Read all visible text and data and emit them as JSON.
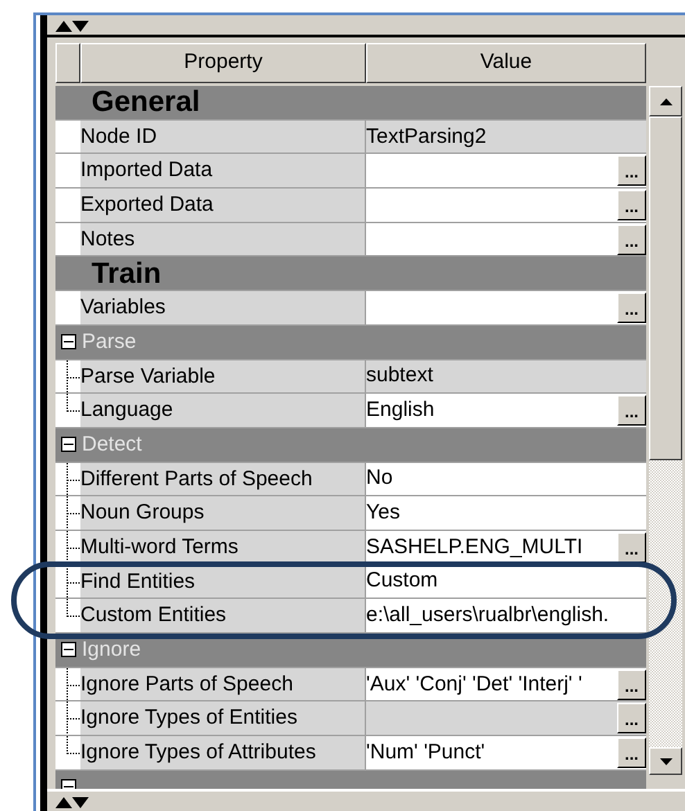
{
  "columns": [
    "Property",
    "Value"
  ],
  "groups": [
    {
      "kind": "section",
      "title": "General",
      "rows": [
        {
          "label": "Node ID",
          "value": "TextParsing2",
          "editable": false
        },
        {
          "label": "Imported Data",
          "editable": true,
          "button": "..."
        },
        {
          "label": "Exported Data",
          "editable": true,
          "button": "..."
        },
        {
          "label": "Notes",
          "editable": true,
          "button": "..."
        }
      ]
    },
    {
      "kind": "section",
      "title": "Train",
      "rows": [
        {
          "label": "Variables",
          "editable": true,
          "button": "..."
        }
      ]
    },
    {
      "kind": "category",
      "title": "Parse",
      "expanded": true,
      "rows": [
        {
          "label": "Parse Variable",
          "value": "subtext",
          "editable": false
        },
        {
          "label": "Language",
          "value": "English",
          "editable": true,
          "button": "..."
        }
      ]
    },
    {
      "kind": "category",
      "title": "Detect",
      "expanded": true,
      "rows": [
        {
          "label": "Different Parts of Speech",
          "value": "No",
          "editable": true
        },
        {
          "label": "Noun Groups",
          "value": "Yes",
          "editable": true
        },
        {
          "label": "Multi-word Terms",
          "value": "SASHELP.ENG_MULTI",
          "editable": true,
          "button": "..."
        },
        {
          "label": "Find Entities",
          "value": "Custom",
          "editable": true
        },
        {
          "label": "Custom Entities",
          "value": "e:\\all_users\\rualbr\\english.",
          "editable": true
        }
      ]
    },
    {
      "kind": "category",
      "title": "Ignore",
      "expanded": true,
      "rows": [
        {
          "label": "Ignore Parts of Speech",
          "value": "'Aux' 'Conj' 'Det' 'Interj' '",
          "editable": true,
          "button": "..."
        },
        {
          "label": "Ignore Types of Entities",
          "editable": false,
          "button": "..."
        },
        {
          "label": "Ignore Types of Attributes",
          "value": "'Num' 'Punct'",
          "editable": true,
          "button": "..."
        }
      ]
    },
    {
      "kind": "category",
      "expanded": true
    }
  ]
}
